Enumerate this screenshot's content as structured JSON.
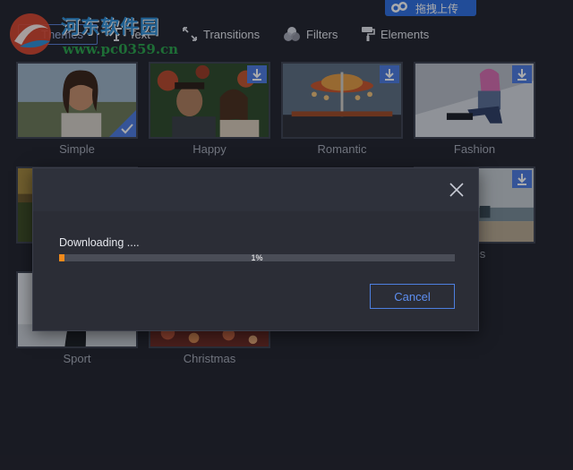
{
  "toolbar": {
    "tabs": [
      {
        "label": "Themes",
        "icon": "themes-icon",
        "active": true
      },
      {
        "label": "Text",
        "icon": "text-icon"
      },
      {
        "label": "Transitions",
        "icon": "transitions-icon"
      },
      {
        "label": "Filters",
        "icon": "filters-icon"
      },
      {
        "label": "Elements",
        "icon": "elements-icon"
      }
    ],
    "upload_chip": "拖拽上传"
  },
  "watermark": {
    "title": "河东软件园",
    "url": "www.pc0359.cn"
  },
  "themes": [
    {
      "label": "Simple",
      "status": "selected"
    },
    {
      "label": "Happy",
      "status": "download"
    },
    {
      "label": "Romantic",
      "status": "download"
    },
    {
      "label": "Fashion",
      "status": "download"
    },
    {
      "label": "",
      "status": "none"
    },
    {
      "label": "mes",
      "status": "download"
    },
    {
      "label": "Sport",
      "status": "none"
    },
    {
      "label": "Christmas",
      "status": "none"
    }
  ],
  "dialog": {
    "status_text": "Downloading ....",
    "progress": 0.01,
    "progress_text": "1%",
    "cancel_label": "Cancel"
  },
  "colors": {
    "accent": "#4e7ce0",
    "progress": "#f08a1c",
    "background": "#22242d"
  }
}
